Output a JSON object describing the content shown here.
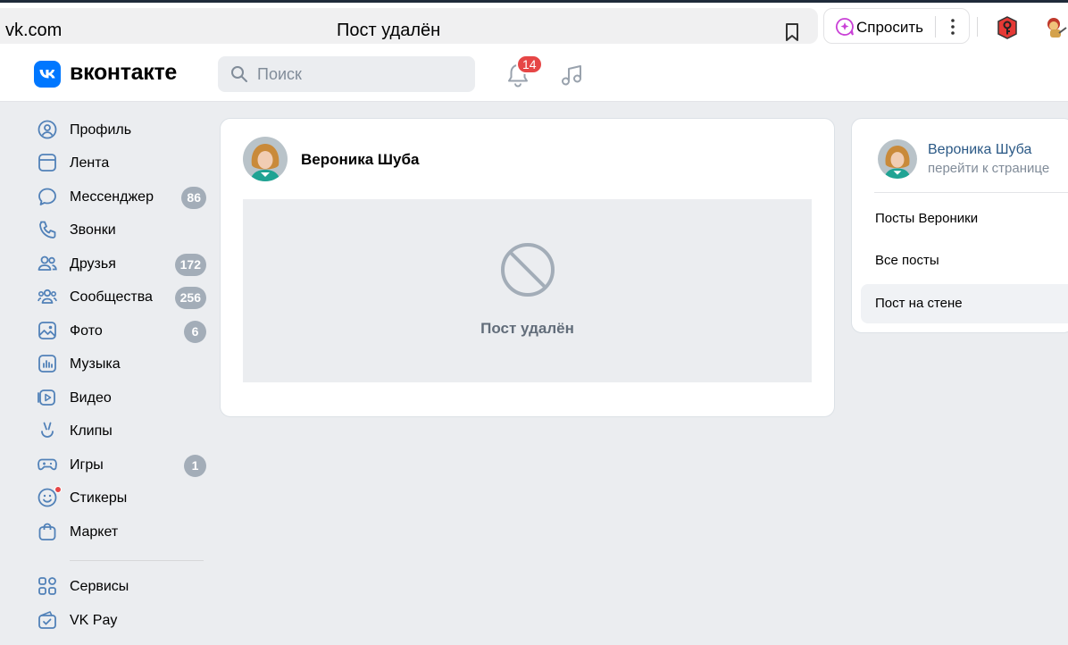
{
  "browser": {
    "url": "vk.com",
    "tab_title": "Пост удалён",
    "ask_label": "Спросить"
  },
  "header": {
    "logo_text": "вконтакте",
    "search_placeholder": "Поиск",
    "notifications_count": "14"
  },
  "sidebar": {
    "items": [
      {
        "label": "Профиль",
        "badge": "",
        "icon": "profile-icon"
      },
      {
        "label": "Лента",
        "badge": "",
        "icon": "feed-icon"
      },
      {
        "label": "Мессенджер",
        "badge": "86",
        "icon": "messenger-icon"
      },
      {
        "label": "Звонки",
        "badge": "",
        "icon": "phone-icon"
      },
      {
        "label": "Друзья",
        "badge": "172",
        "icon": "friends-icon"
      },
      {
        "label": "Сообщества",
        "badge": "256",
        "icon": "communities-icon"
      },
      {
        "label": "Фото",
        "badge": "6",
        "icon": "photo-icon"
      },
      {
        "label": "Музыка",
        "badge": "",
        "icon": "music-icon"
      },
      {
        "label": "Видео",
        "badge": "",
        "icon": "video-icon"
      },
      {
        "label": "Клипы",
        "badge": "",
        "icon": "clips-icon"
      },
      {
        "label": "Игры",
        "badge": "1",
        "icon": "games-icon"
      },
      {
        "label": "Стикеры",
        "badge": "",
        "icon": "stickers-icon"
      },
      {
        "label": "Маркет",
        "badge": "",
        "icon": "market-icon"
      },
      {
        "label": "Сервисы",
        "badge": "",
        "icon": "services-icon"
      },
      {
        "label": "VK Pay",
        "badge": "",
        "icon": "vkpay-icon"
      }
    ]
  },
  "post": {
    "author": "Вероника Шуба",
    "status_text": "Пост удалён"
  },
  "right_panel": {
    "name": "Вероника Шуба",
    "link": "перейти к странице",
    "items": [
      {
        "label": "Посты Вероники",
        "active": false
      },
      {
        "label": "Все посты",
        "active": false
      },
      {
        "label": "Пост на стене",
        "active": true
      }
    ]
  },
  "colors": {
    "vk_blue": "#0077ff",
    "badge_red": "#e64646",
    "badge_gray": "#a3adb8",
    "link_blue": "#2a5885"
  }
}
